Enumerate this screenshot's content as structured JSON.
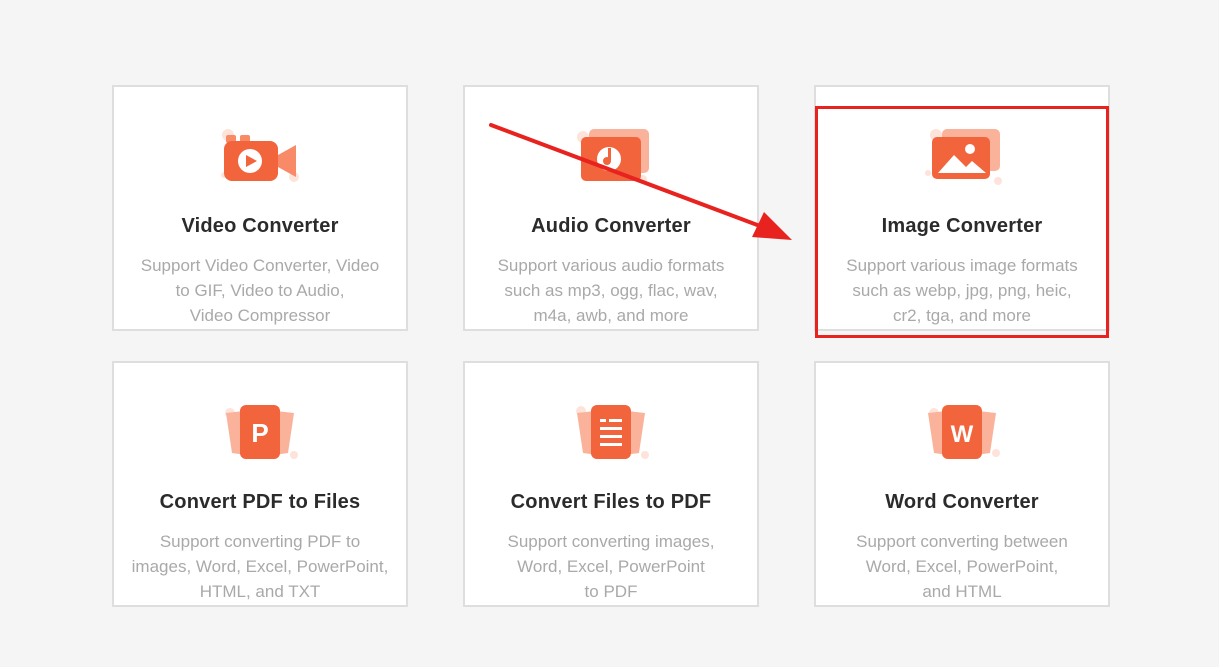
{
  "colors": {
    "accent": "#f2643c",
    "accent_light": "#fbb29a",
    "annotation_red": "#e8231f"
  },
  "cards": [
    {
      "icon": "video-camera-icon",
      "title": "Video Converter",
      "desc_lines": [
        "Support Video Converter, Video",
        "to GIF, Video to Audio,",
        "Video Compressor"
      ]
    },
    {
      "icon": "audio-music-icon",
      "title": "Audio Converter",
      "desc_lines": [
        "Support various audio formats",
        "such as mp3, ogg, flac, wav,",
        "m4a, awb, and more"
      ]
    },
    {
      "icon": "image-picture-icon",
      "title": "Image Converter",
      "desc_lines": [
        "Support various image formats",
        "such as webp, jpg, png, heic,",
        "cr2, tga, and more"
      ]
    },
    {
      "icon": "pdf-p-document-icon",
      "icon_letter": "P",
      "title": "Convert PDF to Files",
      "desc_lines": [
        "Support converting PDF to",
        "images, Word, Excel, PowerPoint,",
        "HTML, and TXT"
      ]
    },
    {
      "icon": "files-document-icon",
      "title": "Convert Files to PDF",
      "desc_lines": [
        "Support converting images,",
        "Word, Excel, PowerPoint",
        "to PDF"
      ]
    },
    {
      "icon": "word-w-document-icon",
      "icon_letter": "W",
      "title": "Word Converter",
      "desc_lines": [
        "Support converting between",
        "Word, Excel, PowerPoint,",
        "and HTML"
      ]
    }
  ]
}
